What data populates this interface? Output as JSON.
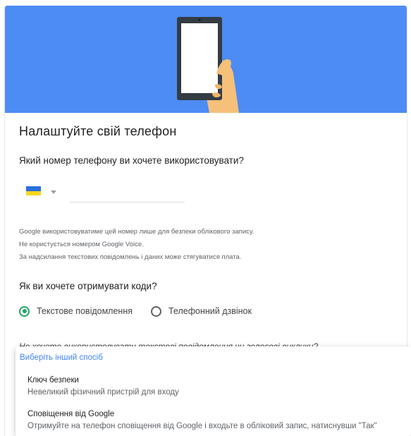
{
  "title": "Налаштуйте свій телефон",
  "phone": {
    "question": "Який номер телефону ви хочете використовувати?",
    "country_flag": "ukraine-flag",
    "value": "",
    "placeholder": ""
  },
  "notes": [
    "Google використовуватиме цей номер лише для безпеки облікового запису.",
    "Не користується номером Google Voice.",
    "За надсилання текстових повідомлень і даних може стягуватися плата."
  ],
  "codes": {
    "question": "Як ви хочете отримувати коди?",
    "options": [
      {
        "label": "Текстове повідомлення",
        "selected": true
      },
      {
        "label": "Телефонний дзвінок",
        "selected": false
      }
    ]
  },
  "alternative": {
    "question": "Не хочете використовувати текстові повідомлення чи голосові виклики?",
    "menu_header": "Виберіть інший спосіб",
    "items": [
      {
        "title": "Ключ безпеки",
        "subtitle": "Невеликий фізичний пристрій для входу"
      },
      {
        "title": "Сповіщення від Google",
        "subtitle": "Отримуйте на телефон сповіщення від Google і входьте в обліковий запис, натиснувши \"Так\""
      }
    ]
  },
  "colors": {
    "hero_background": "#4d8cf5",
    "radio_selected": "#1fa463",
    "link": "#4285f4",
    "flag_blue": "#2a6fdb",
    "flag_yellow": "#f9d71c"
  }
}
